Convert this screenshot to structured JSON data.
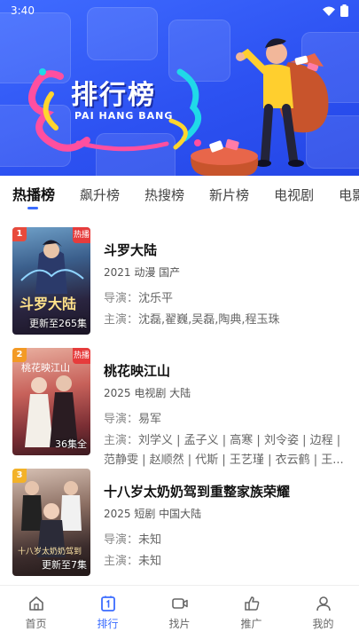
{
  "status": {
    "time": "3:40"
  },
  "banner": {
    "title_cn": "排行榜",
    "title_en": "PAI HANG BANG"
  },
  "tabs": [
    {
      "label": "热播榜",
      "active": true
    },
    {
      "label": "飙升榜",
      "active": false
    },
    {
      "label": "热搜榜",
      "active": false
    },
    {
      "label": "新片榜",
      "active": false
    },
    {
      "label": "电视剧",
      "active": false
    },
    {
      "label": "电影",
      "active": false
    }
  ],
  "items": [
    {
      "rank": "1",
      "badge": "热播",
      "episodes": "更新至265集",
      "title": "斗罗大陆",
      "meta": "2021  动漫  国产",
      "director_label": "导演：",
      "director": "沈乐平",
      "cast_label": "主演：",
      "cast": "沈磊,翟巍,吴磊,陶典,程玉珠"
    },
    {
      "rank": "2",
      "badge": "热播",
      "episodes": "36集全",
      "title": "桃花映江山",
      "meta": "2025  电视剧  大陆",
      "director_label": "导演：",
      "director": "易军",
      "cast_label": "主演：",
      "cast": "刘学义 | 孟子义 | 高寒 | 刘令姿 | 边程 | 范静雯 | 赵顺然 | 代斯 | 王艺瑾 | 衣云鹤 | 王..."
    },
    {
      "rank": "3",
      "badge": "",
      "episodes": "更新至7集",
      "title": "十八岁太奶奶驾到重整家族荣耀",
      "meta": "2025  短剧  中国大陆",
      "director_label": "导演：",
      "director": "未知",
      "cast_label": "主演：",
      "cast": "未知"
    }
  ],
  "nav": [
    {
      "label": "首页",
      "icon": "home-icon",
      "active": false
    },
    {
      "label": "排行",
      "icon": "ranking-icon",
      "active": true
    },
    {
      "label": "找片",
      "icon": "video-icon",
      "active": false
    },
    {
      "label": "推广",
      "icon": "promote-icon",
      "active": false
    },
    {
      "label": "我的",
      "icon": "user-icon",
      "active": false
    }
  ],
  "colors": {
    "accent": "#3b6cff",
    "rank1": "#e84a3c",
    "rank2": "#f39a25",
    "rank3": "#f3b229"
  }
}
